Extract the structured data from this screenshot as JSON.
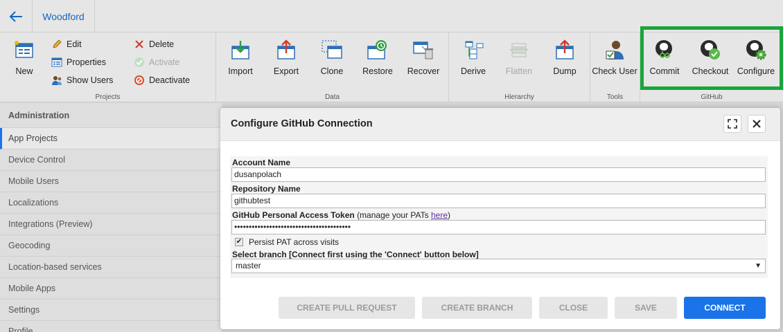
{
  "header": {
    "app_name": "Woodford"
  },
  "ribbon": {
    "groups": {
      "projects": "Projects",
      "data": "Data",
      "hierarchy": "Hierarchy",
      "tools": "Tools",
      "github": "GitHub"
    },
    "projects": {
      "new": "New",
      "edit": "Edit",
      "properties": "Properties",
      "show_users": "Show Users",
      "delete": "Delete",
      "activate": "Activate",
      "deactivate": "Deactivate"
    },
    "data": {
      "import": "Import",
      "export": "Export",
      "clone": "Clone",
      "restore": "Restore",
      "recover": "Recover"
    },
    "hierarchy": {
      "derive": "Derive",
      "flatten": "Flatten",
      "dump": "Dump"
    },
    "tools": {
      "check_user": "Check User"
    },
    "github": {
      "commit": "Commit",
      "checkout": "Checkout",
      "configure": "Configure"
    }
  },
  "sidebar": {
    "heading": "Administration",
    "items": [
      "App Projects",
      "Device Control",
      "Mobile Users",
      "Localizations",
      "Integrations (Preview)",
      "Geocoding",
      "Location-based services",
      "Mobile Apps",
      "Settings",
      "Profile"
    ]
  },
  "dialog": {
    "title": "Configure GitHub Connection",
    "account_label": "Account Name",
    "account_value": "dusanpolach",
    "repo_label": "Repository Name",
    "repo_value": "githubtest",
    "token_label": "GitHub Personal Access Token",
    "token_hint_prefix": "(manage your PATs ",
    "token_hint_link": "here",
    "token_hint_suffix": ")",
    "token_value": "••••••••••••••••••••••••••••••••••••••••",
    "persist_label": "Persist PAT across visits",
    "persist_checked": true,
    "branch_label": "Select branch [Connect first using the 'Connect' button below]",
    "branch_value": "master",
    "buttons": {
      "create_pr": "CREATE PULL REQUEST",
      "create_branch": "CREATE BRANCH",
      "close": "CLOSE",
      "save": "SAVE",
      "connect": "CONNECT"
    }
  },
  "colors": {
    "accent": "#1a73e8",
    "highlight": "#19a53a",
    "link": "#5b2ca0"
  }
}
